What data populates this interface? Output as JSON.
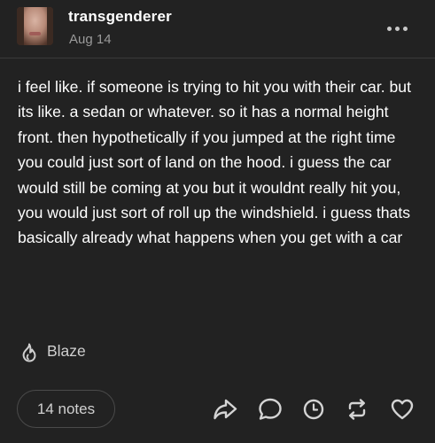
{
  "post": {
    "author": "transgenderer",
    "date": "Aug 14",
    "body": "i feel like. if someone is trying to hit you with their car. but its like. a sedan or whatever. so it has a normal height front. then hypothetically if you jumped at the right time you could just sort of land on the hood. i guess the car would still be coming at you but it wouldnt really hit you, you would just sort of roll up the windshield. i guess thats basically already what happens when you get with a car"
  },
  "actions": {
    "blaze_label": "Blaze",
    "notes_label": "14 notes"
  },
  "icons": {
    "menu": "more-dots-icon",
    "blaze": "flame-icon",
    "share": "share-arrow-icon",
    "reply": "speech-bubble-icon",
    "later": "clock-icon",
    "reblog": "reblog-icon",
    "like": "heart-icon"
  },
  "colors": {
    "background": "#222222",
    "text": "#ffffff",
    "muted": "#9a9a9a",
    "icon": "#d4d4d4"
  }
}
